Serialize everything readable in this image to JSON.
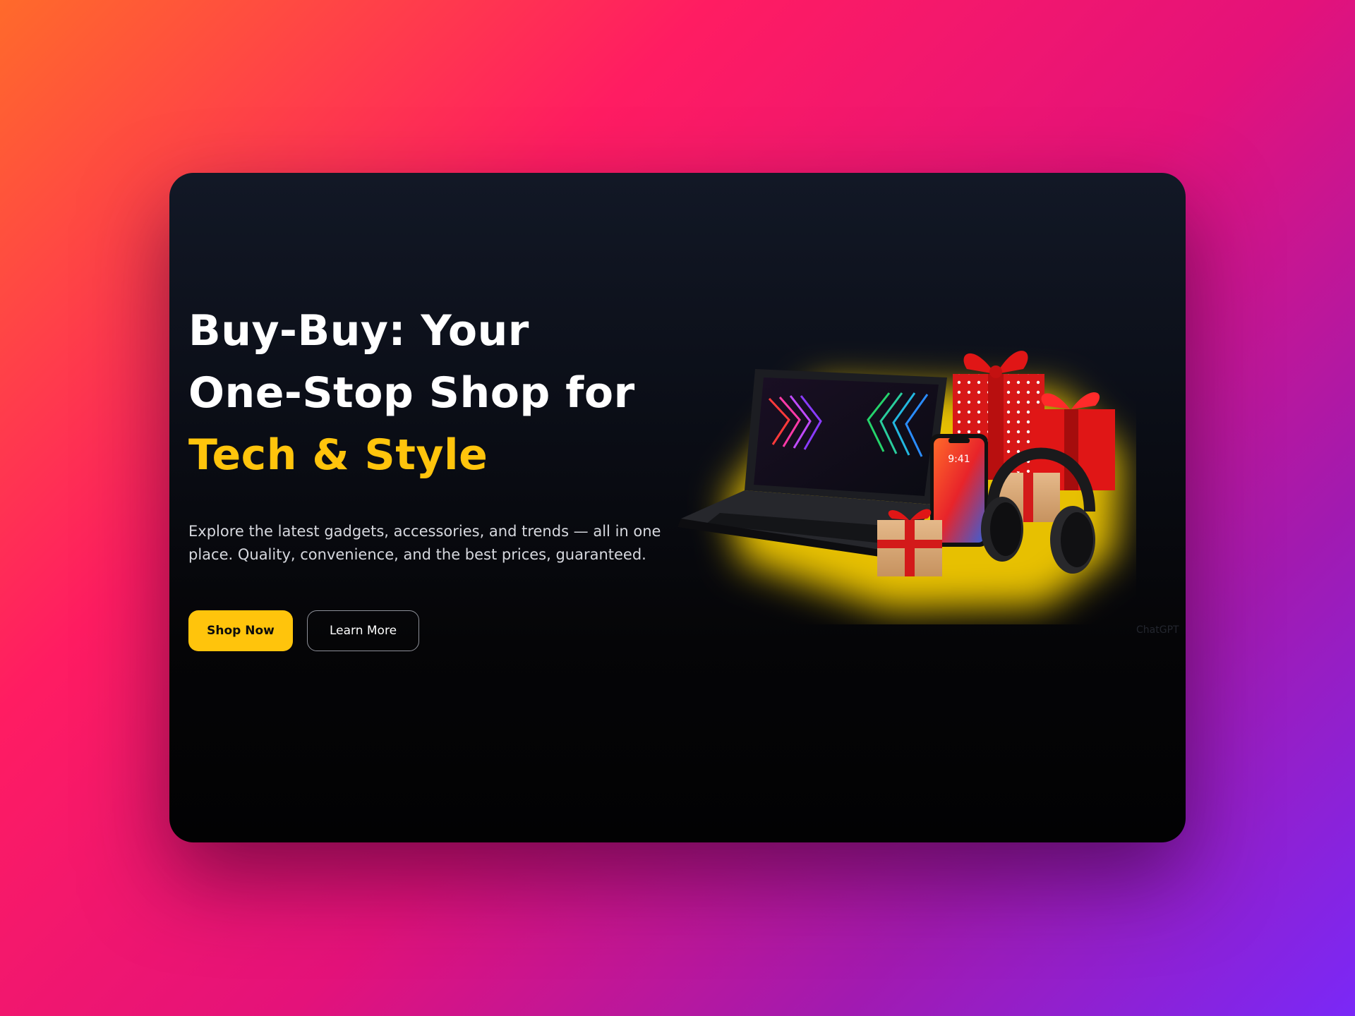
{
  "hero": {
    "headline_line1": "Buy-Buy: Your",
    "headline_line2": "One-Stop Shop for",
    "headline_accent": "Tech & Style",
    "description": "Explore the latest gadgets, accessories, and trends — all in one place. Quality, convenience, and the best prices, guaranteed."
  },
  "buttons": {
    "primary_label": "Shop Now",
    "secondary_label": "Learn More"
  },
  "product_image": {
    "phone_time": "9:41"
  },
  "watermark": "ChatGPT",
  "colors": {
    "accent": "#ffc40c",
    "card_background": "#050507",
    "gift_red": "#e01616"
  }
}
